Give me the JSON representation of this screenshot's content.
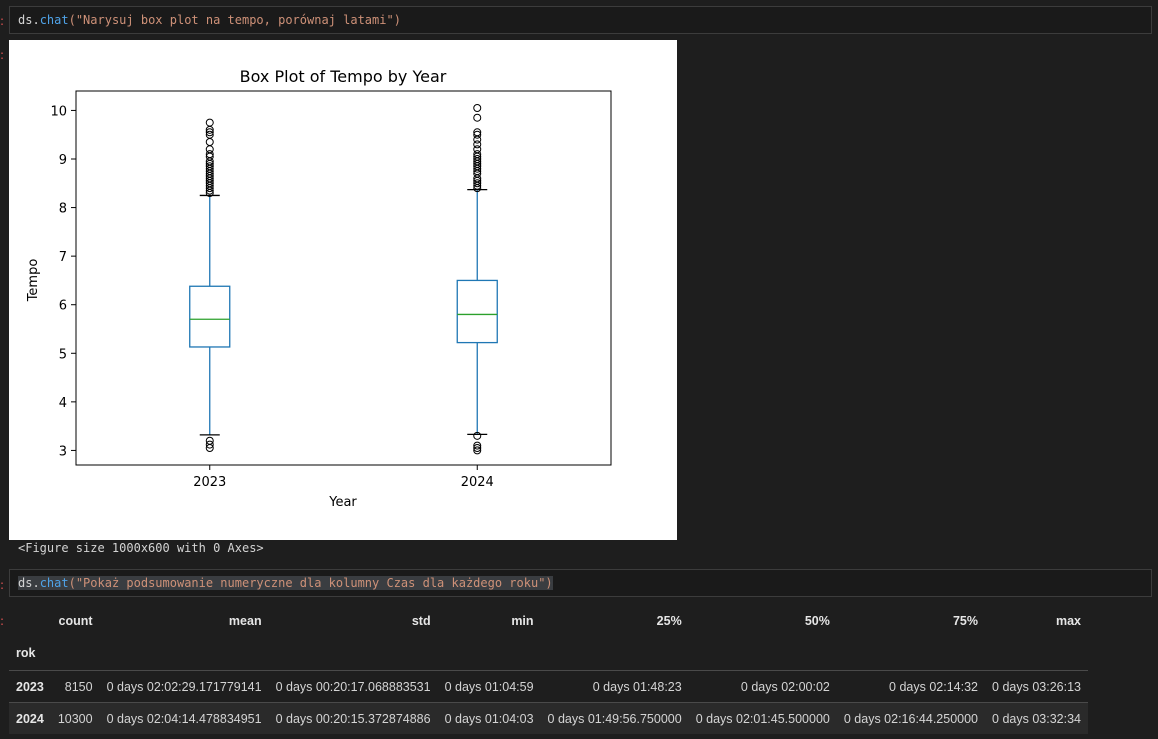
{
  "cell1": {
    "obj": "ds.",
    "fn": "chat",
    "arg": "(\"Narysuj box plot na tempo, porównaj latami\")"
  },
  "cell2": {
    "obj": "ds.",
    "fn": "chat",
    "arg": "(\"Pokaż podsumowanie numeryczne dla kolumny Czas dla każdego roku\")"
  },
  "figure_text": "<Figure size 1000x600 with 0 Axes>",
  "chart_data": {
    "type": "box",
    "title": "Box Plot of Tempo by Year",
    "xlabel": "Year",
    "ylabel": "Tempo",
    "categories": [
      "2023",
      "2024"
    ],
    "y_ticks": [
      3,
      4,
      5,
      6,
      7,
      8,
      9,
      10
    ],
    "ylim": [
      2.7,
      10.4
    ],
    "boxes": [
      {
        "whisker_low": 3.32,
        "q1": 5.13,
        "median": 5.7,
        "q3": 6.38,
        "whisker_high": 8.25,
        "outliers": [
          3.05,
          3.12,
          3.2,
          8.3,
          8.35,
          8.4,
          8.45,
          8.5,
          8.55,
          8.6,
          8.65,
          8.7,
          8.75,
          8.8,
          8.85,
          8.9,
          8.95,
          9.05,
          9.1,
          9.2,
          9.35,
          9.5,
          9.55,
          9.6,
          9.75
        ]
      },
      {
        "whisker_low": 3.33,
        "q1": 5.22,
        "median": 5.8,
        "q3": 6.5,
        "whisker_high": 8.37,
        "outliers": [
          3.0,
          3.05,
          3.1,
          3.3,
          8.4,
          8.45,
          8.5,
          8.55,
          8.6,
          8.7,
          8.75,
          8.8,
          8.85,
          8.9,
          8.95,
          9.0,
          9.05,
          9.1,
          9.2,
          9.3,
          9.4,
          9.5,
          9.55,
          9.85,
          10.05
        ]
      }
    ],
    "colors": {
      "box": "#1f77b4",
      "median": "#2ca02c",
      "cap": "#000000"
    }
  },
  "summary_table": {
    "index_name": "rok",
    "columns": [
      "count",
      "mean",
      "std",
      "min",
      "25%",
      "50%",
      "75%",
      "max"
    ],
    "rows": [
      {
        "index": "2023",
        "values": [
          "8150",
          "0 days 02:02:29.171779141",
          "0 days 00:20:17.068883531",
          "0 days 01:04:59",
          "0 days 01:48:23",
          "0 days 02:00:02",
          "0 days 02:14:32",
          "0 days 03:26:13"
        ]
      },
      {
        "index": "2024",
        "values": [
          "10300",
          "0 days 02:04:14.478834951",
          "0 days 00:20:15.372874886",
          "0 days 01:04:03",
          "0 days 01:49:56.750000",
          "0 days 02:01:45.500000",
          "0 days 02:16:44.250000",
          "0 days 03:32:34"
        ]
      }
    ]
  }
}
